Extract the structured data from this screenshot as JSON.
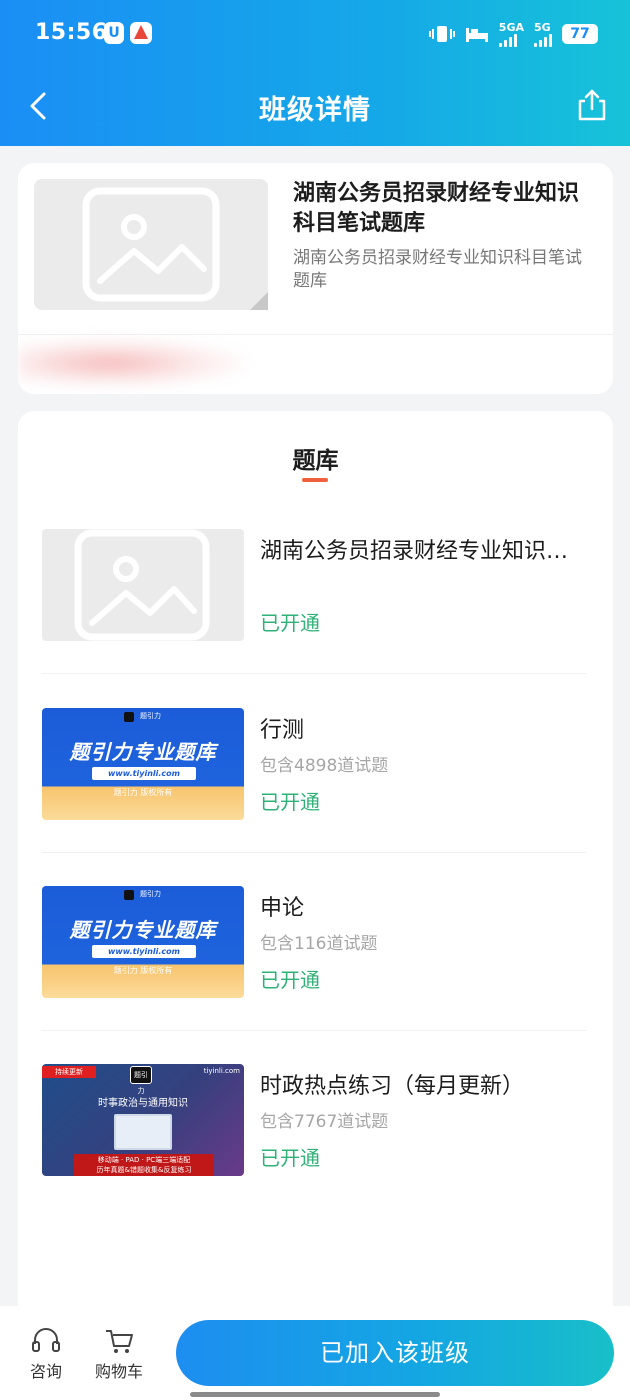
{
  "status_bar": {
    "time": "15:56",
    "app_badge_1": "U",
    "net_1": "5GA",
    "net_2": "5G",
    "battery": "77"
  },
  "nav": {
    "title": "班级详情",
    "back_icon": "chevron-left-icon",
    "share_icon": "share-icon"
  },
  "class_card": {
    "title": "湖南公务员招录财经专业知识科目笔试题库",
    "subtitle": "湖南公务员招录财经专业知识科目笔试题库"
  },
  "question_bank": {
    "tab_label": "题库",
    "items": [
      {
        "title": "湖南公务员招录财经专业知识科目笔试题库",
        "count": "",
        "status": "已开通",
        "thumb": "placeholder"
      },
      {
        "title": "行测",
        "count": "包含4898道试题",
        "status": "已开通",
        "thumb": "promo"
      },
      {
        "title": "申论",
        "count": "包含116道试题",
        "status": "已开通",
        "thumb": "promo"
      },
      {
        "title": "时政热点练习（每月更新）",
        "count": "包含7767道试题",
        "status": "已开通",
        "thumb": "news"
      }
    ],
    "promo_thumb": {
      "brand": "题引力",
      "title": "题引力专业题库",
      "url": "www.tiyinli.com",
      "rights": "题引力 版权所有"
    },
    "news_thumb": {
      "badge": "持续更新",
      "logo": "题引力",
      "site": "tiyinli.com",
      "title": "时事政治与通用知识",
      "bar_line_1": "移动端 · PAD · PC端三端适配",
      "bar_line_2": "历年真题&错题收集&反复练习"
    }
  },
  "bottom_bar": {
    "consult_label": "咨询",
    "cart_label": "购物车",
    "main_button": "已加入该班级"
  },
  "colors": {
    "header_start": "#1a8ef5",
    "header_end": "#17c3d8",
    "status_open": "#2fb277",
    "tab_accent": "#f0603c"
  }
}
